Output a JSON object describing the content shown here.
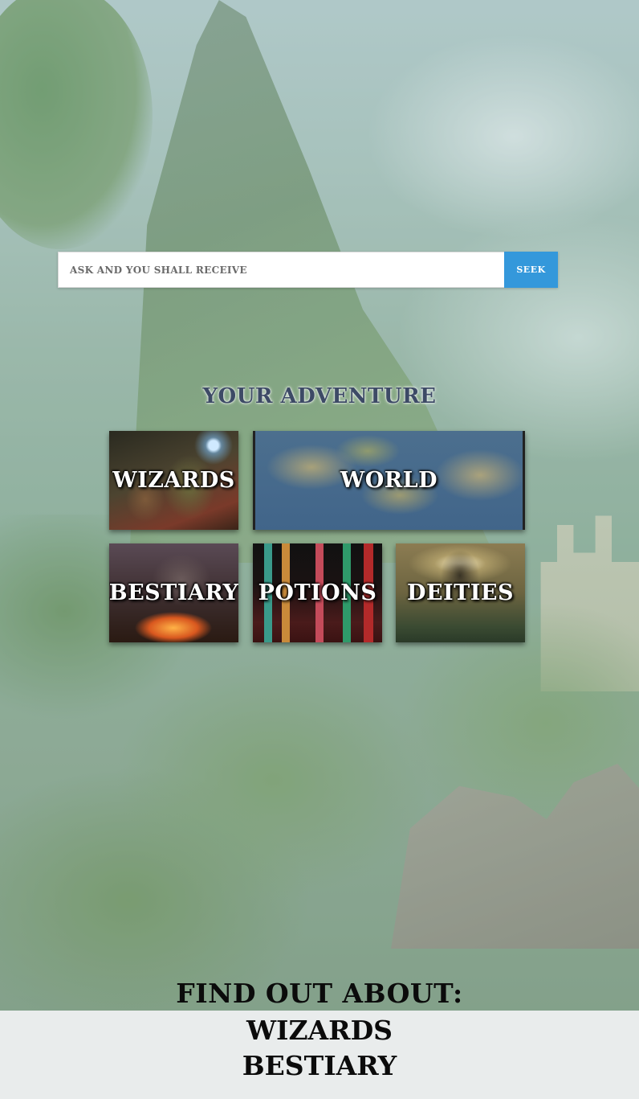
{
  "search": {
    "placeholder": "ASK AND YOU SHALL RECEIVE",
    "button_label": "SEEK",
    "button_color": "#3498db"
  },
  "adventure": {
    "title": "YOUR ADVENTURE",
    "tiles": [
      {
        "label": "WIZARDS"
      },
      {
        "label": "WORLD"
      },
      {
        "label": "BESTIARY"
      },
      {
        "label": "POTIONS"
      },
      {
        "label": "DEITIES"
      }
    ]
  },
  "footer": {
    "title": "FIND OUT ABOUT:",
    "links": [
      "WIZARDS",
      "BESTIARY"
    ],
    "background": "#e9ecec"
  }
}
